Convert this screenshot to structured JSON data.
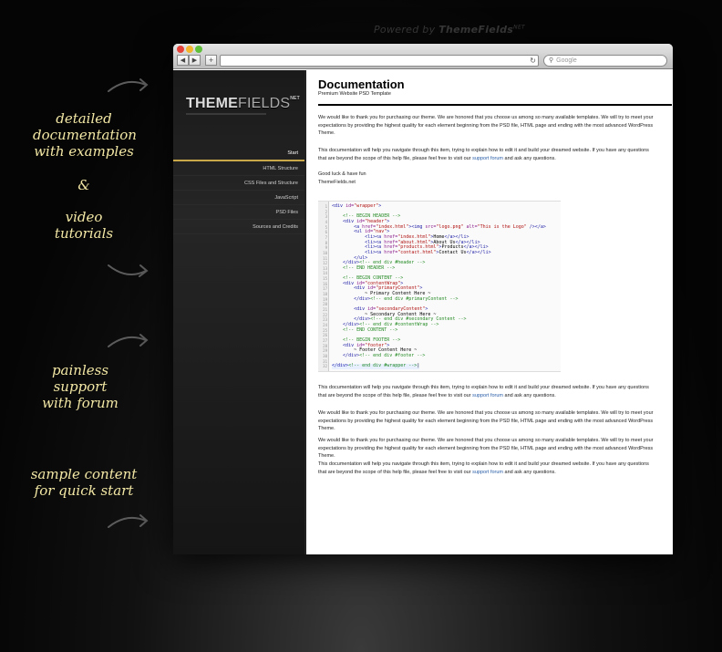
{
  "powered": {
    "prefix": "Powered by ",
    "brand": "ThemeFields",
    "sup": "NET"
  },
  "features": [
    {
      "line1": "detailed",
      "line2": "documentation",
      "line3": "with examples"
    },
    {
      "symbol": "&"
    },
    {
      "line1": "video",
      "line2": "tutorials"
    },
    {
      "line1": "painless",
      "line2": "support",
      "line3": "with forum"
    },
    {
      "line1": "sample content",
      "line2": "for quick start"
    }
  ],
  "browser": {
    "back": "◀",
    "forward": "▶",
    "add": "+",
    "reload": "↻",
    "search_placeholder": "Google"
  },
  "logo": {
    "bold": "THEME",
    "thin": "FIELDS",
    "sup": "NET"
  },
  "nav": [
    {
      "label": "Start",
      "active": true
    },
    {
      "label": "HTML Structure"
    },
    {
      "label": "CSS Files and Structure"
    },
    {
      "label": "JavaScript"
    },
    {
      "label": "PSD Files"
    },
    {
      "label": "Sources and Credits"
    }
  ],
  "doc": {
    "title": "Documentation",
    "subtitle": "Premium Website PSD Template",
    "p1": "We would like to thank you for purchasing our theme. We are honored that you choose us among so many available templates. We will try to meet your expectations by providing the highest quality for each element beginning from the PSD file, HTML page and ending with the most advanced WordPress Theme.",
    "p2_before": "This documentation will help you navigate through this item, trying to explain how to edit it and build your dreamed website. If you have any questions that are beyond the scope of this help file, please feel free to visit our ",
    "p2_link": "support forum",
    "p2_after": " and ask any questions.",
    "p3a": "Good luck & have fun",
    "p3b": "ThemeFields.net",
    "p4_before": "This documentation will help you navigate through this item, trying to explain how to edit it and build your dreamed website. If you have any questions that are beyond the scope of this help file, please feel free to visit our ",
    "p4_link": "support forum",
    "p4_after": " and ask any questions.",
    "p5": "We would like to thank you for purchasing our theme. We are honored that you choose us among so many available templates. We will try to meet your expectations by providing the highest quality for each element beginning from the PSD file, HTML page and ending with the most advanced WordPress Theme.",
    "p6": "We would like to thank you for purchasing our theme. We are honored that you choose us among so many available templates. We will try to meet your expectations by providing the highest quality for each element beginning from the PSD file, HTML page and ending with the most advanced WordPress Theme.",
    "p7_before": "This documentation will help you navigate through this item, trying to explain how to edit it and build your dreamed website. If you have any questions that are beyond the scope of this help file, please feel free to visit our ",
    "p7_link": "support forum",
    "p7_after": " and ask any questions."
  },
  "code_lines": [
    [
      [
        "tag",
        "<div "
      ],
      [
        "attr",
        "id="
      ],
      [
        "str",
        "\"wrapper\""
      ],
      [
        "tag",
        ">"
      ]
    ],
    [],
    [
      [
        "txt",
        "    "
      ],
      [
        "cmt",
        "<!-- BEGIN HEADER -->"
      ]
    ],
    [
      [
        "txt",
        "    "
      ],
      [
        "tag",
        "<div "
      ],
      [
        "attr",
        "id="
      ],
      [
        "str",
        "\"header\""
      ],
      [
        "tag",
        ">"
      ]
    ],
    [
      [
        "txt",
        "        "
      ],
      [
        "tag",
        "<a "
      ],
      [
        "attr",
        "href="
      ],
      [
        "str",
        "\"index.html\""
      ],
      [
        "tag",
        "><img "
      ],
      [
        "attr",
        "src="
      ],
      [
        "str",
        "\"logo.png\""
      ],
      [
        "attr",
        " alt="
      ],
      [
        "str",
        "\"This is the Logo\""
      ],
      [
        "tag",
        " /></a>"
      ]
    ],
    [
      [
        "txt",
        "        "
      ],
      [
        "tag",
        "<ul "
      ],
      [
        "attr",
        "id="
      ],
      [
        "str",
        "\"nav\""
      ],
      [
        "tag",
        ">"
      ]
    ],
    [
      [
        "txt",
        "            "
      ],
      [
        "tag",
        "<li><a "
      ],
      [
        "attr",
        "href="
      ],
      [
        "str",
        "\"index.html\""
      ],
      [
        "tag",
        ">"
      ],
      [
        "txt",
        "Home"
      ],
      [
        "tag",
        "</a></li>"
      ]
    ],
    [
      [
        "txt",
        "            "
      ],
      [
        "tag",
        "<li><a "
      ],
      [
        "attr",
        "href="
      ],
      [
        "str",
        "\"about.html\""
      ],
      [
        "tag",
        ">"
      ],
      [
        "txt",
        "About Us"
      ],
      [
        "tag",
        "</a></li>"
      ]
    ],
    [
      [
        "txt",
        "            "
      ],
      [
        "tag",
        "<li><a "
      ],
      [
        "attr",
        "href="
      ],
      [
        "str",
        "\"products.html\""
      ],
      [
        "tag",
        ">"
      ],
      [
        "txt",
        "Products"
      ],
      [
        "tag",
        "</a></li>"
      ]
    ],
    [
      [
        "txt",
        "            "
      ],
      [
        "tag",
        "<li><a "
      ],
      [
        "attr",
        "href="
      ],
      [
        "str",
        "\"contact.html\""
      ],
      [
        "tag",
        ">"
      ],
      [
        "txt",
        "Contact Us"
      ],
      [
        "tag",
        "</a></li>"
      ]
    ],
    [
      [
        "txt",
        "        "
      ],
      [
        "tag",
        "</ul>"
      ]
    ],
    [
      [
        "txt",
        "    "
      ],
      [
        "tag",
        "</div>"
      ],
      [
        "cmt",
        "<!-- end div #header -->"
      ]
    ],
    [
      [
        "txt",
        "    "
      ],
      [
        "cmt",
        "<!-- END HEADER -->"
      ]
    ],
    [],
    [
      [
        "txt",
        "    "
      ],
      [
        "cmt",
        "<!-- BEGIN CONTENT -->"
      ]
    ],
    [
      [
        "txt",
        "    "
      ],
      [
        "tag",
        "<div "
      ],
      [
        "attr",
        "id="
      ],
      [
        "str",
        "\"contentWrap\""
      ],
      [
        "tag",
        ">"
      ]
    ],
    [
      [
        "txt",
        "        "
      ],
      [
        "tag",
        "<div "
      ],
      [
        "attr",
        "id="
      ],
      [
        "str",
        "\"primaryContent\""
      ],
      [
        "tag",
        ">"
      ]
    ],
    [
      [
        "txt",
        "            ~ Primary Content Here ~"
      ]
    ],
    [
      [
        "txt",
        "        "
      ],
      [
        "tag",
        "</div>"
      ],
      [
        "cmt",
        "<!-- end div #primaryContent -->"
      ]
    ],
    [],
    [
      [
        "txt",
        "        "
      ],
      [
        "tag",
        "<div "
      ],
      [
        "attr",
        "id="
      ],
      [
        "str",
        "\"secondaryContent\""
      ],
      [
        "tag",
        ">"
      ]
    ],
    [
      [
        "txt",
        "            ~ Secondary Content Here ~"
      ]
    ],
    [
      [
        "txt",
        "        "
      ],
      [
        "tag",
        "</div>"
      ],
      [
        "cmt",
        "<!-- end div #secondary Content -->"
      ]
    ],
    [
      [
        "txt",
        "    "
      ],
      [
        "tag",
        "</div>"
      ],
      [
        "cmt",
        "<!-- end div #contentWrap -->"
      ]
    ],
    [
      [
        "txt",
        "    "
      ],
      [
        "cmt",
        "<!-- END CONTENT -->"
      ]
    ],
    [],
    [
      [
        "txt",
        "    "
      ],
      [
        "cmt",
        "<!-- BEGIN FOOTER -->"
      ]
    ],
    [
      [
        "txt",
        "    "
      ],
      [
        "tag",
        "<div "
      ],
      [
        "attr",
        "id="
      ],
      [
        "str",
        "\"footer\""
      ],
      [
        "tag",
        ">"
      ]
    ],
    [
      [
        "txt",
        "        ~ Footer Content Here ~"
      ]
    ],
    [
      [
        "txt",
        "    "
      ],
      [
        "tag",
        "</div>"
      ],
      [
        "cmt",
        "<!-- end div #footer -->"
      ]
    ],
    [],
    [
      [
        "tag",
        "</div>"
      ],
      [
        "cmt",
        "<!-- end div #wrapper -->"
      ],
      [
        "txt",
        "|"
      ]
    ]
  ]
}
